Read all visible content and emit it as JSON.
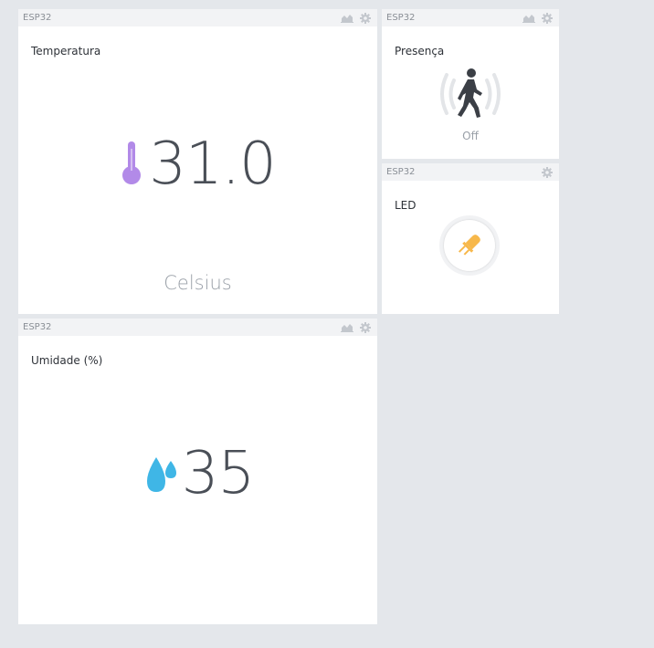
{
  "widgets": {
    "temperature": {
      "device": "ESP32",
      "title": "Temperatura",
      "value": "31.0",
      "unit": "Celsius",
      "icon": "thermometer-icon",
      "icon_color": "#b28ae8"
    },
    "presence": {
      "device": "ESP32",
      "title": "Presença",
      "state": "Off",
      "icon": "motion-sensor-icon"
    },
    "led": {
      "device": "ESP32",
      "title": "LED",
      "icon": "led-icon",
      "icon_color": "#f7b84b"
    },
    "humidity": {
      "device": "ESP32",
      "title": "Umidade (%)",
      "value": "35",
      "icon": "water-drops-icon",
      "icon_color": "#3fb6e6"
    }
  },
  "colors": {
    "background": "#e4e7eb",
    "widget_header": "#f2f3f5",
    "text_dark": "#4a4f57",
    "text_muted": "#9aa0a8"
  }
}
